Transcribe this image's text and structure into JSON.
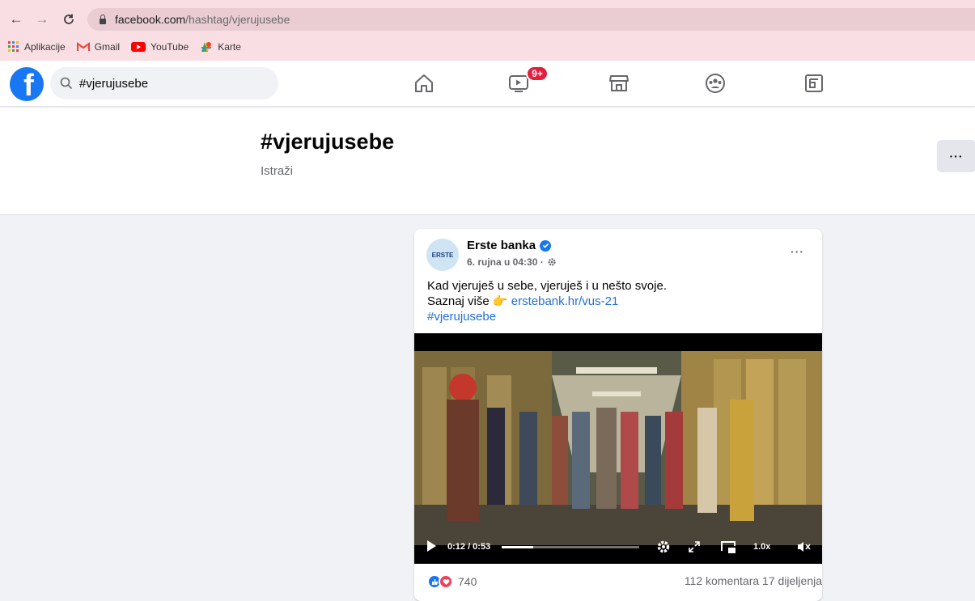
{
  "browser": {
    "url_domain": "facebook.com",
    "url_path": "/hashtag/vjerujusebe",
    "bookmarks": [
      {
        "label": "Aplikacije",
        "icon": "apps-grid-icon"
      },
      {
        "label": "Gmail",
        "icon": "gmail-icon"
      },
      {
        "label": "YouTube",
        "icon": "youtube-icon"
      },
      {
        "label": "Karte",
        "icon": "maps-icon"
      }
    ]
  },
  "header": {
    "search_value": "#vjerujusebe",
    "watch_badge": "9+",
    "nav_icons": [
      "home-icon",
      "watch-icon",
      "marketplace-icon",
      "groups-icon",
      "gaming-icon"
    ]
  },
  "hashtag": {
    "title": "#vjerujusebe",
    "subtitle": "Istraži",
    "more_label": "···"
  },
  "post": {
    "author": "Erste banka",
    "avatar_text": "ERSTE",
    "meta": "6. rujna u 04:30 ·",
    "more_label": "···",
    "text_line1": "Kad vjeruješ u sebe, vjeruješ i u nešto svoje.",
    "text_line2_prefix": "Saznaj više",
    "text_line2_emoji": "👉",
    "text_link": "erstebank.hr/vus-21",
    "hashtag": "#vjerujusebe",
    "video": {
      "time": "0:12 / 0:53",
      "progress": 0.23,
      "speed": "1.0x"
    },
    "reaction_count": "740",
    "comments_shares": "112 komentara  17 dijeljenja"
  }
}
